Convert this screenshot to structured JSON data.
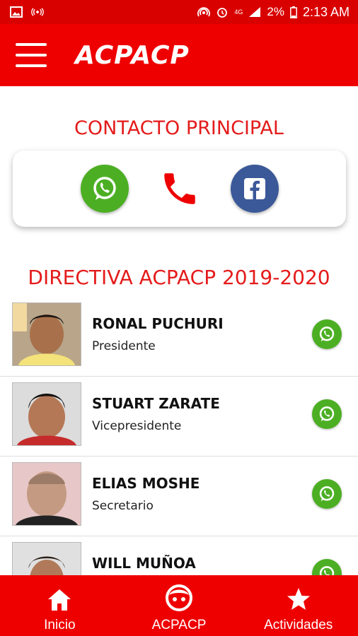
{
  "status_bar": {
    "battery": "2%",
    "time": "2:13 AM",
    "network": "4G"
  },
  "app_bar": {
    "title": "ACPACP"
  },
  "contact_section": {
    "title": "CONTACTO PRINCIPAL",
    "icons": [
      "whatsapp-icon",
      "phone-icon",
      "facebook-icon"
    ]
  },
  "directiva": {
    "title": "DIRECTIVA ACPACP 2019-2020",
    "members": [
      {
        "name": "RONAL PUCHURI",
        "role": "Presidente"
      },
      {
        "name": "STUART ZARATE",
        "role": "Vicepresidente"
      },
      {
        "name": "ELIAS MOSHE",
        "role": "Secretario"
      },
      {
        "name": "WILL MUÑOA",
        "role": ""
      }
    ]
  },
  "bottom_nav": {
    "items": [
      {
        "label": "Inicio",
        "icon": "home-icon"
      },
      {
        "label": "ACPACP",
        "icon": "face-icon"
      },
      {
        "label": "Actividades",
        "icon": "star-icon"
      }
    ]
  },
  "colors": {
    "primary_red": "#ee0000",
    "title_red": "#e41b1b",
    "whatsapp_green": "#4caf23",
    "facebook_blue": "#3b5998"
  }
}
